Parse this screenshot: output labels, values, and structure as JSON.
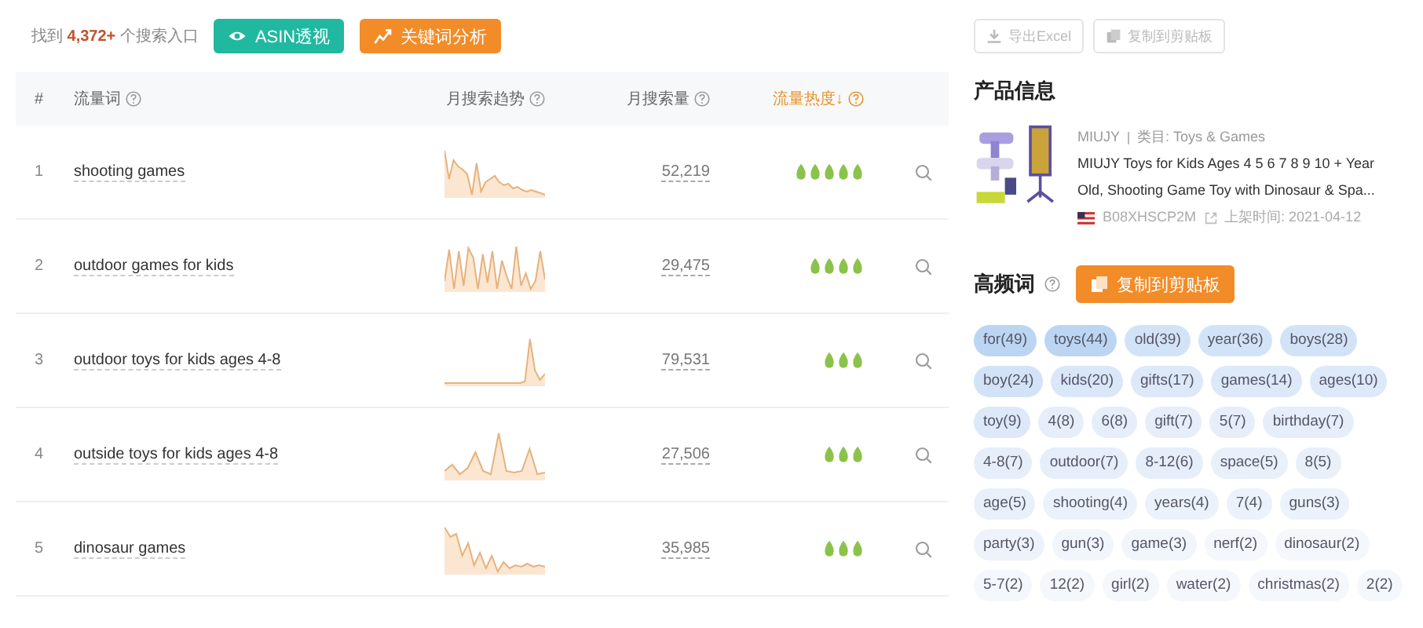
{
  "summary": {
    "prefix": "找到",
    "count": "4,372+",
    "suffix": "个搜索入口"
  },
  "buttons": [
    {
      "label": "ASIN透视",
      "kind": "asin"
    },
    {
      "label": "关键词分析",
      "kind": "keyword"
    }
  ],
  "table": {
    "columns": [
      {
        "label": "#",
        "help": false,
        "sorted": false
      },
      {
        "label": "流量词",
        "help": true,
        "sorted": false
      },
      {
        "label": "月搜索趋势",
        "help": true,
        "sorted": false
      },
      {
        "label": "月搜索量",
        "help": true,
        "sorted": false
      },
      {
        "label": "流量热度",
        "help": true,
        "sorted": true,
        "sort_mark": "↓"
      }
    ],
    "rows": [
      {
        "index": "1",
        "keyword": "shooting games",
        "volume": "52,219",
        "stars": 5
      },
      {
        "index": "2",
        "keyword": "outdoor games for kids",
        "volume": "29,475",
        "stars": 4
      },
      {
        "index": "3",
        "keyword": "outdoor toys for kids ages 4-8",
        "volume": "79,531",
        "stars": 3
      },
      {
        "index": "4",
        "keyword": "outside toys for kids ages 4-8",
        "volume": "27,506",
        "stars": 3
      },
      {
        "index": "5",
        "keyword": "dinosaur games",
        "volume": "35,985",
        "stars": 3
      }
    ]
  },
  "export_buttons": [
    {
      "label": "导出Excel",
      "kind": "download"
    },
    {
      "label": "复制到剪贴板",
      "kind": "copy"
    }
  ],
  "product": {
    "title": "产品信息",
    "brand": "MIUJY",
    "category": "类目: Toys & Games",
    "name": "MIUJY Toys for Kids Ages 4 5 6 7 8 9 10 + Year Old, Shooting Game Toy with Dinosaur & Spa...",
    "asin": "B08XHSCP2M",
    "listed": "上架时间: 2021-04-12"
  },
  "keywords": {
    "title": "高频词",
    "copy_button": "复制到剪贴板",
    "tags": [
      {
        "label": "for(49)",
        "color": "#bcd5f3"
      },
      {
        "label": "toys(44)",
        "color": "#bcd5f3"
      },
      {
        "label": "old(39)",
        "color": "#d3e3f7"
      },
      {
        "label": "year(36)",
        "color": "#d3e3f7"
      },
      {
        "label": "boys(28)",
        "color": "#d3e3f7"
      },
      {
        "label": "boy(24)",
        "color": "#d3e3f7"
      },
      {
        "label": "kids(20)",
        "color": "#d9e7f8"
      },
      {
        "label": "gifts(17)",
        "color": "#dde9f8"
      },
      {
        "label": "games(14)",
        "color": "#dde9f8"
      },
      {
        "label": "ages(10)",
        "color": "#dde9f8"
      },
      {
        "label": "toy(9)",
        "color": "#dde9f8"
      },
      {
        "label": "4(8)",
        "color": "#e6eefa"
      },
      {
        "label": "6(8)",
        "color": "#e6eefa"
      },
      {
        "label": "gift(7)",
        "color": "#e6eefa"
      },
      {
        "label": "5(7)",
        "color": "#e6eefa"
      },
      {
        "label": "birthday(7)",
        "color": "#e6eefa"
      },
      {
        "label": "4-8(7)",
        "color": "#e6eefa"
      },
      {
        "label": "outdoor(7)",
        "color": "#e6eefa"
      },
      {
        "label": "8-12(6)",
        "color": "#e6eefa"
      },
      {
        "label": "space(5)",
        "color": "#e9f0fa"
      },
      {
        "label": "8(5)",
        "color": "#e9f0fa"
      },
      {
        "label": "age(5)",
        "color": "#e9f0fa"
      },
      {
        "label": "shooting(4)",
        "color": "#ecf2fb"
      },
      {
        "label": "years(4)",
        "color": "#ecf2fb"
      },
      {
        "label": "7(4)",
        "color": "#ecf2fb"
      },
      {
        "label": "guns(3)",
        "color": "#ecf2fb"
      },
      {
        "label": "party(3)",
        "color": "#eef3fb"
      },
      {
        "label": "gun(3)",
        "color": "#f1f5fc"
      },
      {
        "label": "game(3)",
        "color": "#f1f5fc"
      },
      {
        "label": "nerf(2)",
        "color": "#f4f7fc"
      },
      {
        "label": "dinosaur(2)",
        "color": "#f4f7fc"
      },
      {
        "label": "5-7(2)",
        "color": "#f4f7fc"
      },
      {
        "label": "12(2)",
        "color": "#f4f7fc"
      },
      {
        "label": "girl(2)",
        "color": "#f4f7fc"
      },
      {
        "label": "water(2)",
        "color": "#f4f7fc"
      },
      {
        "label": "christmas(2)",
        "color": "#f4f7fc"
      },
      {
        "label": "2(2)",
        "color": "#f4f7fc"
      }
    ]
  }
}
